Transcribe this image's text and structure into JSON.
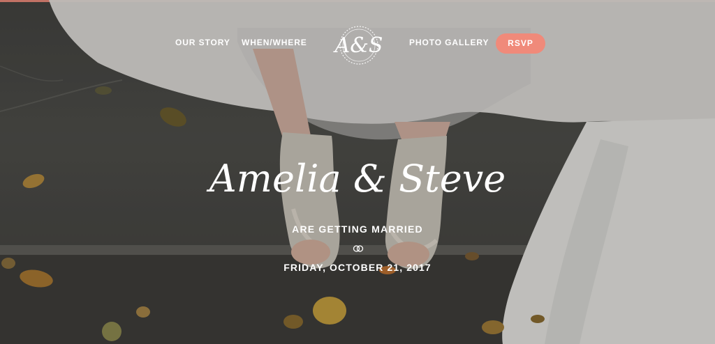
{
  "nav": {
    "our_story": "OUR STORY",
    "when_where": "WHEN/WHERE",
    "monogram": "A&S",
    "photo_gallery": "PHOTO GALLERY",
    "rsvp": "RSVP"
  },
  "hero": {
    "couple_names": "Amelia & Steve",
    "subtitle": "ARE GETTING MARRIED",
    "date": "FRIDAY, OCTOBER 21, 2017"
  },
  "colors": {
    "accent": "#f08a7a",
    "text": "#ffffff"
  },
  "icons": [
    "monogram-logo",
    "wedding-rings-icon"
  ]
}
